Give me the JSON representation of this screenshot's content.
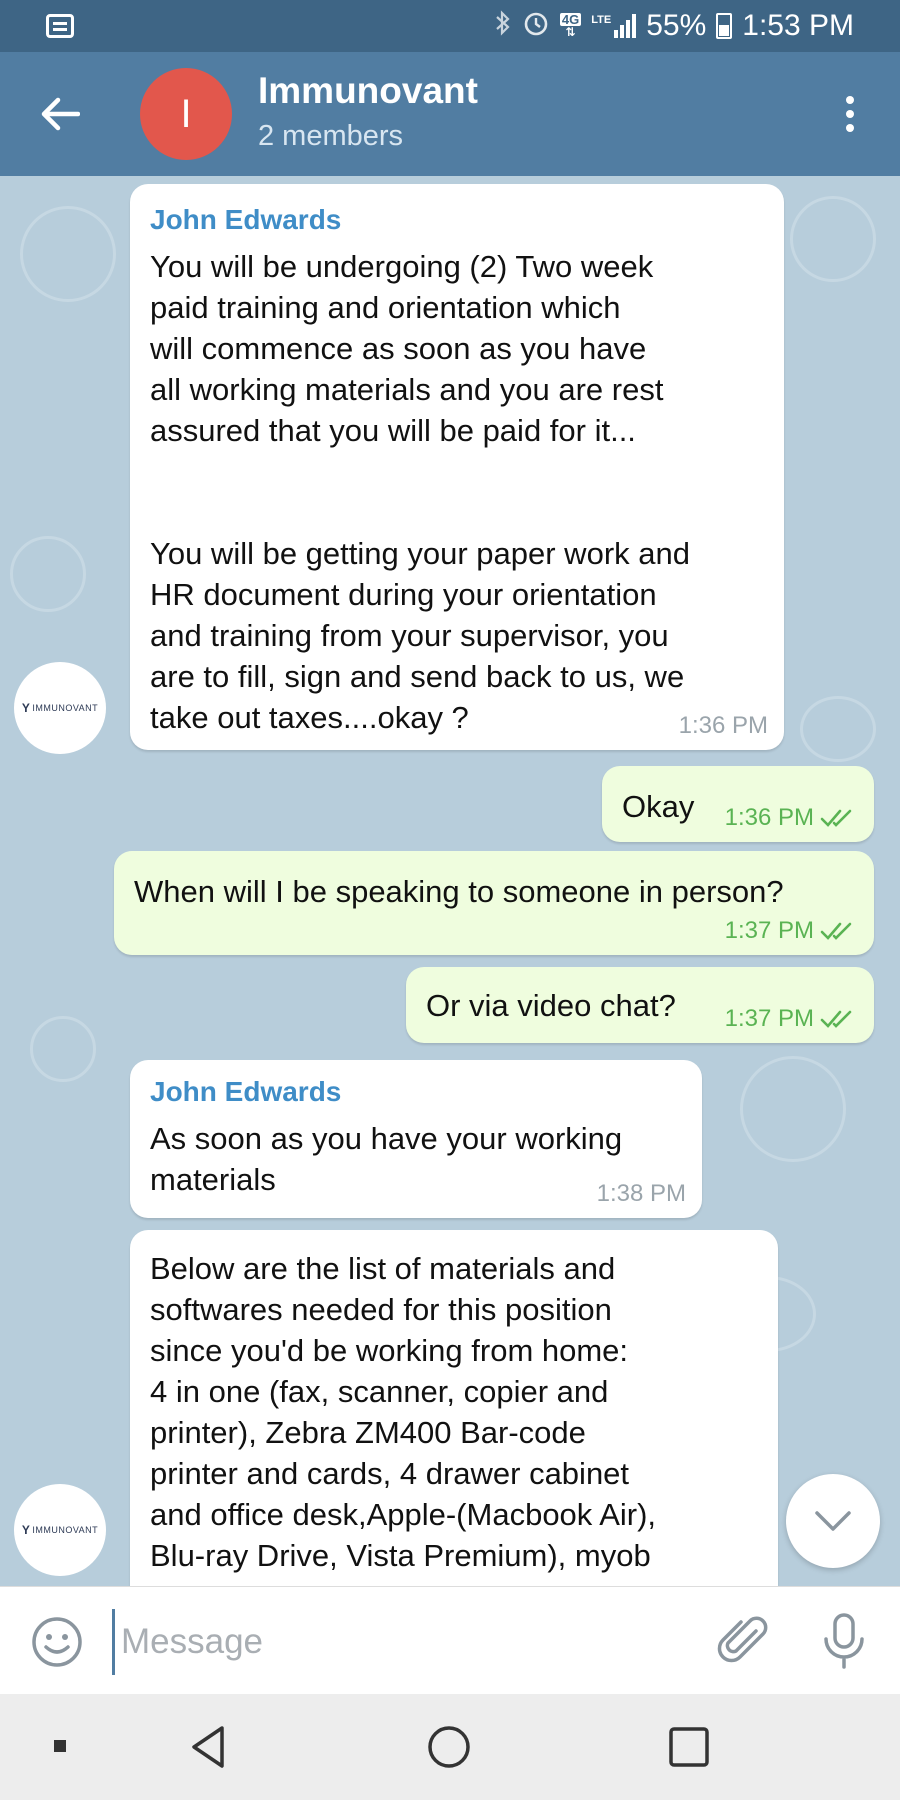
{
  "status_bar": {
    "icons": [
      "notification-icon",
      "bluetooth-icon",
      "alarm-icon",
      "4g-icon",
      "lte-signal-icon",
      "battery-icon"
    ],
    "network_label": "4G",
    "lte_label": "LTE",
    "battery": "55%",
    "time": "1:53 PM"
  },
  "header": {
    "avatar_letter": "I",
    "avatar_color": "#e2574c",
    "title": "Immunovant",
    "subtitle": "2 members",
    "bar_color": "#517da2"
  },
  "avatar_logo_text": "IMMUNOVANT",
  "messages": [
    {
      "direction": "in",
      "sender": "John Edwards",
      "text": "You will be undergoing (2) Two week\npaid training and orientation which\nwill commence as soon as you have\nall working materials and you are rest\nassured that you will be paid for it...\n\n\nYou will be getting your paper work and\nHR document during your orientation\nand training from your supervisor, you\nare to fill, sign and send back to us, we\ntake out taxes....okay ?",
      "time": "1:36 PM"
    },
    {
      "direction": "out",
      "text": "Okay",
      "time": "1:36 PM"
    },
    {
      "direction": "out",
      "text": "When will I be speaking to someone in person?",
      "time": "1:37 PM"
    },
    {
      "direction": "out",
      "text": "Or via video chat?",
      "time": "1:37 PM"
    },
    {
      "direction": "in",
      "sender": "John Edwards",
      "text": "As soon as you have your working\nmaterials",
      "time": "1:38 PM"
    },
    {
      "direction": "in",
      "text": "Below are the list of materials and\nsoftwares needed for this position\nsince you'd be working from home:\n4 in one (fax, scanner, copier and\nprinter), Zebra ZM400 Bar-code\nprinter and cards, 4 drawer cabinet\nand office desk,Apple-(Macbook Air),\nBlu-ray Drive, Vista Premium), myob"
    }
  ],
  "input": {
    "placeholder": "Message",
    "value": ""
  },
  "colors": {
    "incoming_bubble": "#ffffff",
    "outgoing_bubble": "#effdde",
    "sender_name": "#3f8dc7",
    "read_check": "#5ab353"
  }
}
